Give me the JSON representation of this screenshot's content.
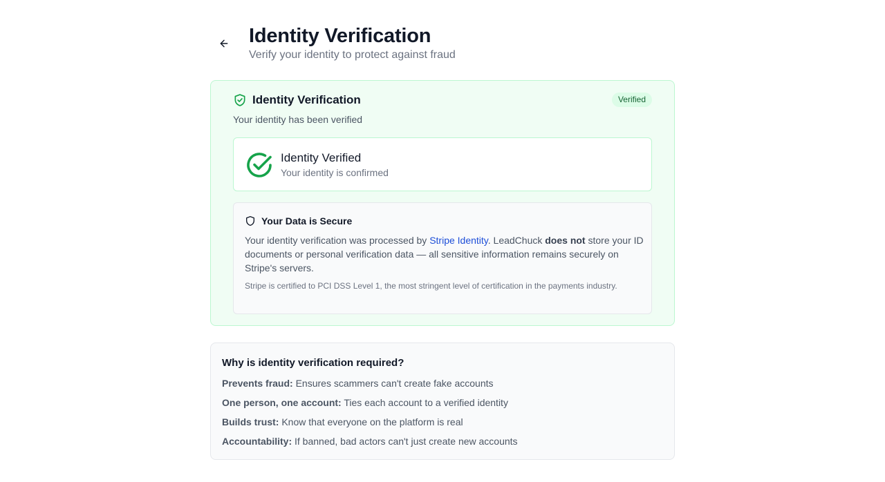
{
  "header": {
    "title": "Identity Verification",
    "subtitle": "Verify your identity to protect against fraud"
  },
  "verification_card": {
    "title": "Identity Verification",
    "badge": "Verified",
    "description": "Your identity has been verified",
    "status": {
      "title": "Identity Verified",
      "subtitle": "Your identity is confirmed"
    },
    "secure": {
      "title": "Your Data is Secure",
      "text_before_link": "Your identity verification was processed by ",
      "link_text": "Stripe Identity",
      "text_after_link": ". LeadChuck ",
      "bold_text": "does not",
      "text_end": " store your ID documents or personal verification data — all sensitive information remains securely on Stripe's servers.",
      "note": "Stripe is certified to PCI DSS Level 1, the most stringent level of certification in the payments industry."
    }
  },
  "why_card": {
    "title": "Why is identity verification required?",
    "items": [
      {
        "label": "Prevents fraud:",
        "text": " Ensures scammers can't create fake accounts"
      },
      {
        "label": "One person, one account:",
        "text": " Ties each account to a verified identity"
      },
      {
        "label": "Builds trust:",
        "text": " Know that everyone on the platform is real"
      },
      {
        "label": "Accountability:",
        "text": " If banned, bad actors can't just create new accounts"
      }
    ]
  },
  "icons": {
    "back": "arrow-left-icon",
    "shield_check": "shield-check-icon",
    "status": "check-circle-icon",
    "secure": "shield-icon"
  },
  "colors": {
    "success_green": "#16a34a",
    "card_background": "#f0fdf4",
    "card_border": "#bbf7d0",
    "link_blue": "#1d4ed8"
  }
}
